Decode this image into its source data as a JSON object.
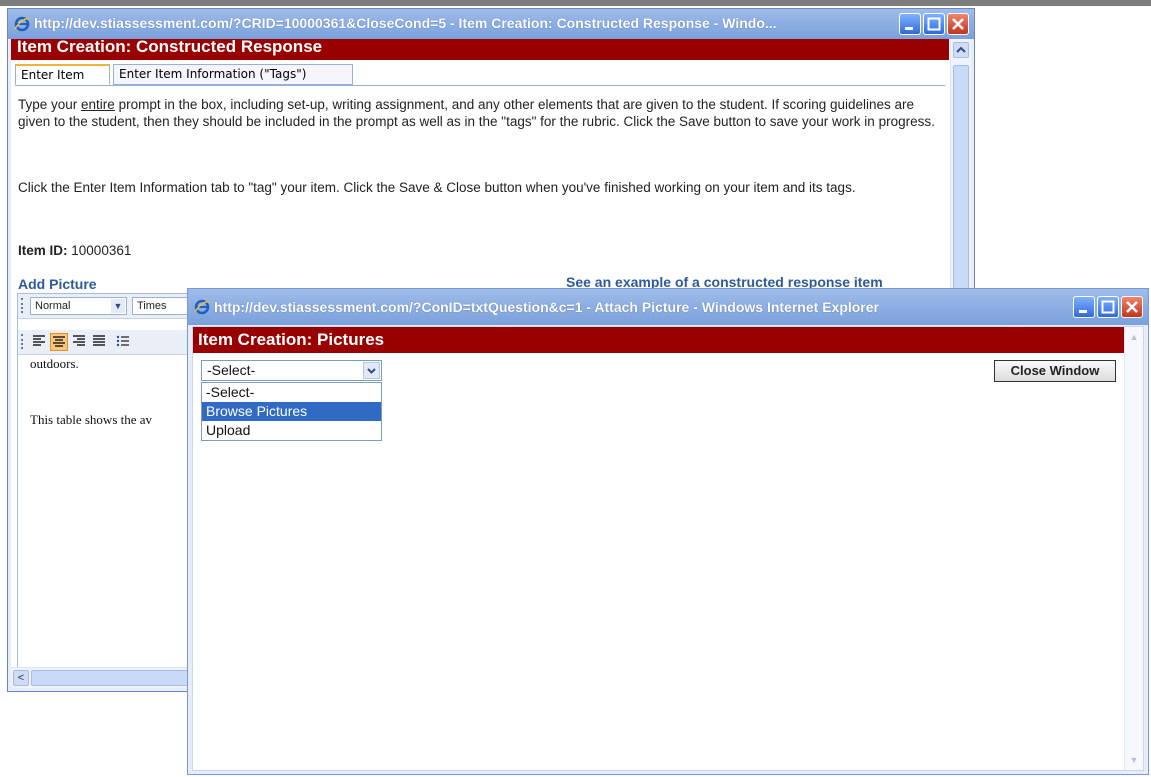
{
  "window_back": {
    "title": "http://dev.stiassessment.com/?CRID=10000361&CloseCond=5 - Item Creation: Constructed Response - Windo...",
    "header": "Item Creation: Constructed Response",
    "tabs": [
      "Enter Item",
      "Enter Item Information (\"Tags\")"
    ],
    "para1_before": "Type your ",
    "para1_underlined": "entire",
    "para1_after": " prompt in the box, including set-up, writing assignment, and any other elements that are given to the student. If scoring guidelines are given to the student, then they should be included in the prompt as well as in the \"tags\" for the rubric. Click the Save button to save your work in progress.",
    "para2": "Click the Enter Item Information tab to \"tag\" your item. Click the Save & Close button when you've finished working on your item and its tags.",
    "item_id_label": "Item ID:",
    "item_id_value": "10000361",
    "add_picture": "Add Picture",
    "see_example": "See an example of a constructed response item",
    "editor": {
      "style_select": "Normal",
      "font_select": "Times",
      "line1": "outdoors.",
      "line2": "This table shows the av"
    }
  },
  "window_front": {
    "title": "http://dev.stiassessment.com/?ConID=txtQuestion&c=1 - Attach Picture - Windows Internet Explorer",
    "header": "Item Creation: Pictures",
    "select_value": "-Select-",
    "options": [
      "-Select-",
      "Browse Pictures",
      "Upload"
    ],
    "highlighted_option": "Browse Pictures",
    "close_button": "Close Window"
  },
  "colors": {
    "header_band": "#990000",
    "titlebar": "#8fb0e4",
    "highlight": "#316ac5",
    "link": "#2e5a9b"
  }
}
